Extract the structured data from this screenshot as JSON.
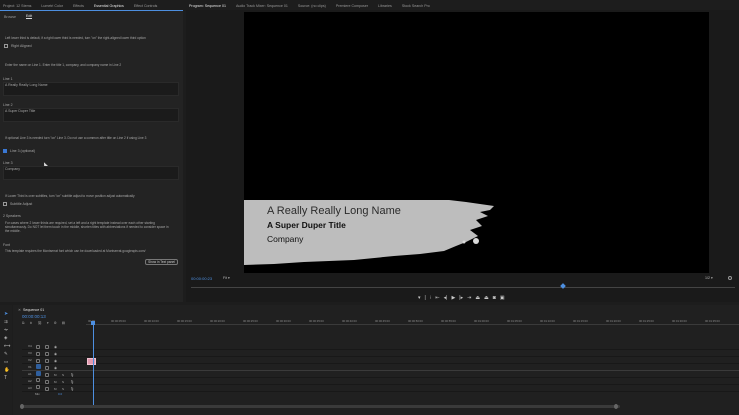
{
  "left_tabs": [
    "Project: 12 Stems",
    "Lumetri Color",
    "Effects",
    "Essential Graphics",
    "Effect Controls"
  ],
  "left_tab_close": "≡",
  "subtabs": [
    "Browse",
    "Edit"
  ],
  "mogrt": {
    "intro": "Left lower third is default, if a right lower third is needed, turn \"on\" the right-aligned lower third option",
    "right_aligned_label": "Right Aligned",
    "enter_names_note": "Enter the name on Line 1. Enter the title 1, company, and company name in Line 2",
    "line1_label": "Line 1",
    "line1_value": "A Really Really Long Name",
    "line2_label": "Line 2",
    "line2_value": "A Super Duper Title",
    "optional_note": "If optional Line 3 is needed turn \"on\" Line 3. Do not use a common after title on Line 2 if using Line 3",
    "line3_checkbox": "Line 3 (optional)",
    "line3_label": "Line 3",
    "line3_value": "Company",
    "subtitle_note": "If Lower Third is over subtitles, turn \"on\" subtitle adjust to move position adjust automatically",
    "subtitle_label": "Subtitle Adjust",
    "speakers_heading": "2 Speakers",
    "speakers_note_1": "For cases where 2 lower thirds are required, set a left and a right template instead over each other starting",
    "speakers_note_2": "simultaneously. Do NOT let them touch in the middle, shorten titles with abbreviations if needed to consider space in",
    "speakers_note_3": "the middle.",
    "font_heading": "Font",
    "font_note": "This template requires the Montserrat font which can be downloaded at Montserrat.googleapis.com/",
    "show_button": "Show in Text panel"
  },
  "monitor_tabs": [
    "Program: Sequence 01",
    "Audio Track Mixer: Sequence 01",
    "Source: (no clips)",
    "Premiere Composer",
    "Libraries",
    "Stock Search Pro"
  ],
  "program": {
    "timecode": "00:00:00:23",
    "fit": "Fit",
    "resolution": "1/2",
    "lower_third": {
      "name": "A Really Really Long Name",
      "title": "A Super Duper Title",
      "company": "Company"
    }
  },
  "timeline": {
    "tab": "Sequence 01",
    "timecode": "00:00:00:13",
    "ruler": [
      "00:00",
      "00:00:05:00",
      "00:00:10:00",
      "00:00:15:00",
      "00:00:20:00",
      "00:00:25:00",
      "00:00:30:00",
      "00:00:35:00",
      "00:00:40:00",
      "00:00:45:00",
      "00:00:50:00",
      "00:00:55:00",
      "00:01:00:00",
      "00:01:05:00",
      "00:01:10:00",
      "00:01:15:00",
      "00:01:20:00",
      "00:01:25:00",
      "00:01:30:00",
      "00:01:35:00"
    ],
    "video_tracks": [
      "V4",
      "V3",
      "V2",
      "V1"
    ],
    "audio_tracks": [
      "A1",
      "A2",
      "A3",
      "A4"
    ],
    "mix_label": "Mix",
    "mix_value": "0.0"
  },
  "colors": {
    "accent": "#4d8fe0",
    "clip": "#e39ab0",
    "lower_third_bg": "#bdbdbd"
  }
}
